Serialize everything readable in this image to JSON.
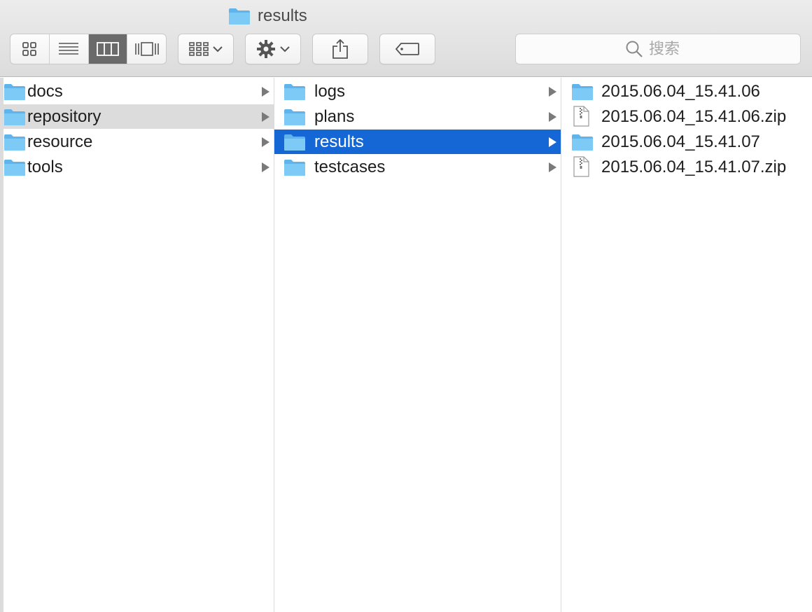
{
  "window": {
    "title": "results"
  },
  "toolbar": {
    "view_modes": [
      {
        "name": "icon-view",
        "active": false
      },
      {
        "name": "list-view",
        "active": false
      },
      {
        "name": "column-view",
        "active": true
      },
      {
        "name": "cover-flow-view",
        "active": false
      }
    ],
    "arrange_icon": "arrange-grid-icon",
    "action_icon": "gear-icon",
    "share_icon": "share-icon",
    "tag_icon": "tag-icon",
    "search": {
      "placeholder": "搜索"
    }
  },
  "columns": [
    {
      "items": [
        {
          "label": "docs",
          "type": "folder",
          "state": "normal"
        },
        {
          "label": "repository",
          "type": "folder",
          "state": "highlighted"
        },
        {
          "label": "resource",
          "type": "folder",
          "state": "normal"
        },
        {
          "label": "tools",
          "type": "folder",
          "state": "normal"
        }
      ]
    },
    {
      "items": [
        {
          "label": "logs",
          "type": "folder",
          "state": "normal"
        },
        {
          "label": "plans",
          "type": "folder",
          "state": "normal"
        },
        {
          "label": "results",
          "type": "folder",
          "state": "selected"
        },
        {
          "label": "testcases",
          "type": "folder",
          "state": "normal"
        }
      ]
    },
    {
      "items": [
        {
          "label": "2015.06.04_15.41.06",
          "type": "folder",
          "state": "normal"
        },
        {
          "label": "2015.06.04_15.41.06.zip",
          "type": "zip",
          "state": "normal"
        },
        {
          "label": "2015.06.04_15.41.07",
          "type": "folder",
          "state": "normal"
        },
        {
          "label": "2015.06.04_15.41.07.zip",
          "type": "zip",
          "state": "normal"
        }
      ]
    }
  ],
  "colors": {
    "selection": "#1667d6",
    "highlight": "#dcdcdc",
    "folder_blue": "#66bdf2"
  }
}
